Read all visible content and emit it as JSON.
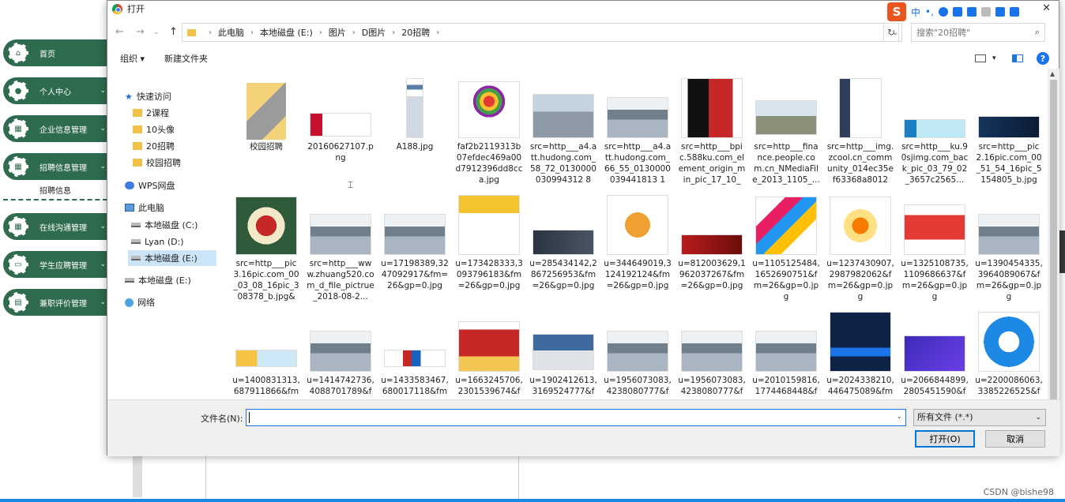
{
  "sidebar": {
    "items": [
      {
        "label": "首页",
        "icon": "home-icon"
      },
      {
        "label": "个人中心",
        "icon": "person-icon"
      },
      {
        "label": "企业信息管理",
        "icon": "grid-icon"
      },
      {
        "label": "招聘信息管理",
        "icon": "grid-icon"
      },
      {
        "label": "在线沟通管理",
        "icon": "grid-icon"
      },
      {
        "label": "学生应聘管理",
        "icon": "monitor-icon"
      },
      {
        "label": "兼职评价管理",
        "icon": "doc-icon"
      }
    ],
    "sub_item": "招聘信息"
  },
  "dialog": {
    "title": "打开",
    "breadcrumb": [
      "此电脑",
      "本地磁盘 (E:)",
      "图片",
      "D图片",
      "20招聘"
    ],
    "search_placeholder": "搜索\"20招聘\"",
    "organize": "组织 ▾",
    "new_folder": "新建文件夹",
    "nav": [
      {
        "label": "快速访问",
        "icon": "star-icon"
      },
      {
        "label": "2课程",
        "icon": "folder-icon"
      },
      {
        "label": "10头像",
        "icon": "folder-icon"
      },
      {
        "label": "20招聘",
        "icon": "folder-icon"
      },
      {
        "label": "校园招聘",
        "icon": "folder-icon"
      },
      {
        "label": "WPS网盘",
        "icon": "cloud-icon"
      },
      {
        "label": "此电脑",
        "icon": "computer-icon"
      },
      {
        "label": "本地磁盘 (C:)",
        "icon": "drive-icon"
      },
      {
        "label": "Lyan (D:)",
        "icon": "drive-icon"
      },
      {
        "label": "本地磁盘 (E:)",
        "icon": "drive-icon"
      },
      {
        "label": "本地磁盘 (E:)",
        "icon": "drive-icon"
      },
      {
        "label": "网络",
        "icon": "network-icon"
      }
    ],
    "files": [
      {
        "name": "校园招聘",
        "thumb": "folder"
      },
      {
        "name": "20160627107.png",
        "thumb": "logo-red"
      },
      {
        "name": "A188.jpg",
        "thumb": "doc"
      },
      {
        "name": "faf2b2119313b07efdec469a00d7912396dd8cca.jpg",
        "thumb": "logo-flower"
      },
      {
        "name": "src=http___a4.att.hudong.com_58_72_0130000030994312 83...",
        "thumb": "photo-gray"
      },
      {
        "name": "src=http___a4.att.hudong.com_66_55_0130000039441813 11...",
        "thumb": "photo-office"
      },
      {
        "name": "src=http___bpic.588ku.com_element_origin_min_pic_17_10_0...",
        "thumb": "red-text"
      },
      {
        "name": "src=http___finance.people.com.cn_NMediaFile_2013_1105_...",
        "thumb": "photo-building"
      },
      {
        "name": "src=http___img.zcool.cn_community_014ec35ef63368a80120...",
        "thumb": "doc-resume"
      },
      {
        "name": "src=http___ku.90sjimg.com_back_pic_03_79_02_3657c2565...",
        "thumb": "banner-blue"
      },
      {
        "name": "src=http___pic2.16pic.com_00_51_54_16pic_5154805_b.jpg&...",
        "thumb": "banner-dark"
      },
      {
        "name": "src=http___pic3.16pic.com_00_03_08_16pic_308378_b.jpg&r...",
        "thumb": "badge-green"
      },
      {
        "name": "src=http___www.zhuang520.com_d_file_pictrue_2018-08-2...",
        "thumb": "photo-office"
      },
      {
        "name": "u=17198389,3247092917&fm=26&gp=0.jpg",
        "thumb": "photo-office"
      },
      {
        "name": "u=173428333,3093796183&fm=26&gp=0.jpg",
        "thumb": "yellow-text"
      },
      {
        "name": "u=285434142,2867256953&fm=26&gp=0.jpg",
        "thumb": "banner-dark2"
      },
      {
        "name": "u=344649019,3124192124&fm=26&gp=0.jpg",
        "thumb": "poster"
      },
      {
        "name": "u=812003629,1962037267&fm=26&gp=0.jpg",
        "thumb": "banner-red"
      },
      {
        "name": "u=1105125484,1652690751&fm=26&gp=0.jpg",
        "thumb": "colorful"
      },
      {
        "name": "u=1237430907,2987982062&fm=26&gp=0.jpg",
        "thumb": "cartoon"
      },
      {
        "name": "u=1325108735,1109686637&fm=26&gp=0.jpg",
        "thumb": "red-text2"
      },
      {
        "name": "u=1390454335,3964089067&fm=26&gp=0.jpg",
        "thumb": "photo-office"
      },
      {
        "name": "u=1400831313,687911866&fm",
        "thumb": "banner-small"
      },
      {
        "name": "u=1414742736,4088701789&f",
        "thumb": "photo-office"
      },
      {
        "name": "u=1433583467,680017118&fm",
        "thumb": "small-figures"
      },
      {
        "name": "u=1663245706,2301539674&f",
        "thumb": "red-text3"
      },
      {
        "name": "u=1902412613,3169524777&f",
        "thumb": "photo-building2"
      },
      {
        "name": "u=1956073083,4238080777&f",
        "thumb": "photo-office"
      },
      {
        "name": "u=1956073083,4238080777&f",
        "thumb": "photo-office"
      },
      {
        "name": "u=2010159816,1774468448&f",
        "thumb": "photo-office"
      },
      {
        "name": "u=2024338210,446475089&fm",
        "thumb": "poster-navy"
      },
      {
        "name": "u=2066844899,2805451590&f",
        "thumb": "tech-purple"
      },
      {
        "name": "u=2200086063,3385226525&f",
        "thumb": "app-blue"
      }
    ],
    "filename_label": "文件名(N):",
    "filename_value": "",
    "filetype": "所有文件 (*.*)",
    "open_label": "打开(O)",
    "cancel_label": "取消"
  },
  "ime": {
    "label": "中",
    "punct": "•,"
  },
  "watermark": "CSDN @bishe98"
}
